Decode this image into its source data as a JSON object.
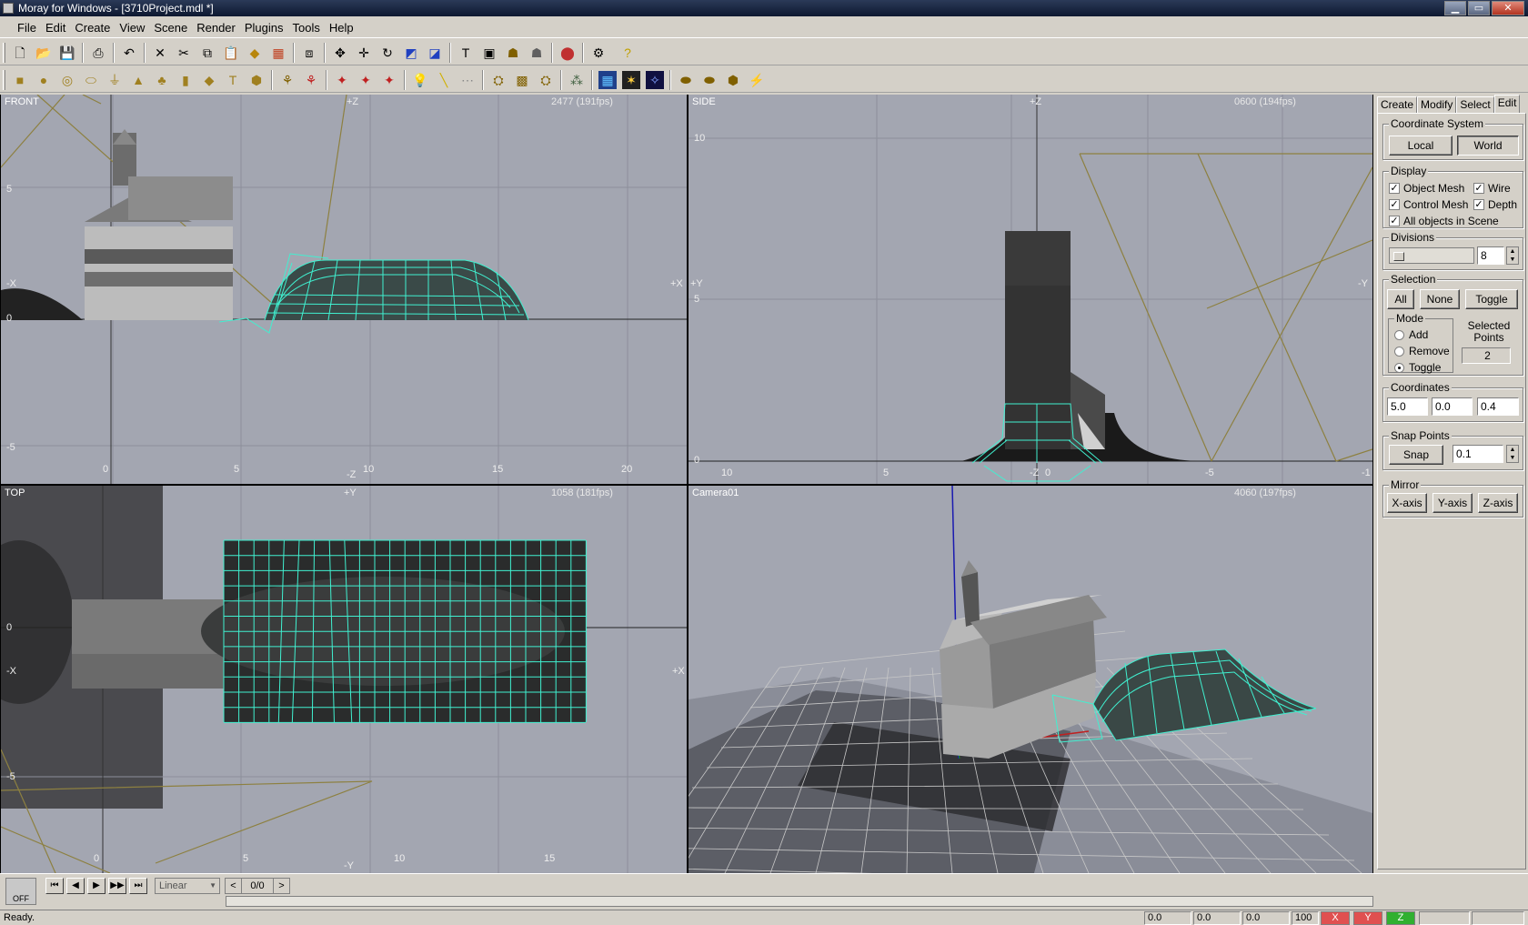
{
  "window": {
    "title": "Moray for Windows - [3710Project.mdl *]",
    "min": "▁",
    "max": "▭",
    "close": "✕"
  },
  "menu": [
    "File",
    "Edit",
    "Create",
    "View",
    "Scene",
    "Render",
    "Plugins",
    "Tools",
    "Help"
  ],
  "viewports": {
    "front": {
      "label": "FRONT",
      "fps": "2477   (191fps)",
      "axes": {
        "top": "+Z",
        "bottom": "-Z",
        "left": "-X",
        "right": "+X"
      },
      "xticks": [
        "0",
        "5",
        "10",
        "15",
        "20"
      ],
      "yticks": [
        "5",
        "0",
        "-5"
      ]
    },
    "side": {
      "label": "SIDE",
      "fps": "0600   (194fps)",
      "axes": {
        "top": "+Z",
        "bottom": "-Z",
        "left": "+Y",
        "right": "-Y"
      },
      "xticks": [
        "10",
        "5",
        "0",
        "-5",
        "-1"
      ],
      "yticks": [
        "10",
        "5",
        "0"
      ]
    },
    "top": {
      "label": "TOP",
      "fps": "1058   (181fps)",
      "axes": {
        "top": "+Y",
        "bottom": "-Y",
        "left": "-X",
        "right": "+X"
      },
      "xticks": [
        "0",
        "5",
        "10",
        "15"
      ],
      "yticks": [
        "0",
        "-5"
      ]
    },
    "camera": {
      "label": "Camera01",
      "fps": "4060   (197fps)"
    }
  },
  "panel": {
    "tabs": [
      "Create",
      "Modify",
      "Select",
      "Edit"
    ],
    "coordinate_system": {
      "title": "Coordinate System",
      "local": "Local",
      "world": "World"
    },
    "display": {
      "title": "Display",
      "object_mesh": "Object Mesh",
      "wire": "Wire",
      "control_mesh": "Control Mesh",
      "depth": "Depth",
      "all_objects": "All objects in Scene"
    },
    "divisions": {
      "title": "Divisions",
      "value": "8"
    },
    "selection": {
      "title": "Selection",
      "all": "All",
      "none": "None",
      "toggle": "Toggle",
      "mode": "Mode",
      "add": "Add",
      "remove": "Remove",
      "toggle_mode": "Toggle",
      "selected_points_label": "Selected Points",
      "selected_points": "2"
    },
    "coordinates": {
      "title": "Coordinates",
      "x": "5.0",
      "y": "0.0",
      "z": "0.4"
    },
    "snap": {
      "title": "Snap Points",
      "button": "Snap",
      "value": "0.1"
    },
    "mirror": {
      "title": "Mirror",
      "x": "X-axis",
      "y": "Y-axis",
      "z": "Z-axis"
    }
  },
  "timeline": {
    "off": "OFF",
    "interpolation": "Linear",
    "frame": "0/0",
    "prev": "<",
    "next": ">"
  },
  "status": {
    "text": "Ready.",
    "x": "0.0",
    "y": "0.0",
    "z": "0.0",
    "zoom": "100",
    "ax": "X",
    "ay": "Y",
    "az": "Z"
  }
}
